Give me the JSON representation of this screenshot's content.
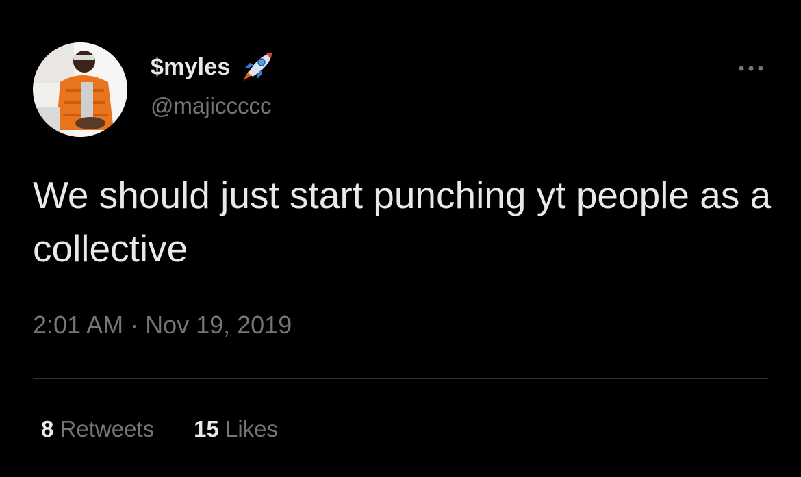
{
  "tweet": {
    "display_name": "$myles",
    "name_emoji_icon": "rocket-icon",
    "handle": "@majiccccc",
    "text": "We should just start punching yt people as a collective",
    "timestamp": "2:01 AM · Nov 19, 2019",
    "more_icon": "more-options-icon",
    "retweets": {
      "count": "8",
      "label": "Retweets"
    },
    "likes": {
      "count": "15",
      "label": "Likes"
    }
  },
  "colors": {
    "background": "#000000",
    "primary_text": "#e7e9ea",
    "secondary_text": "#71767b",
    "divider": "#2f3336"
  }
}
